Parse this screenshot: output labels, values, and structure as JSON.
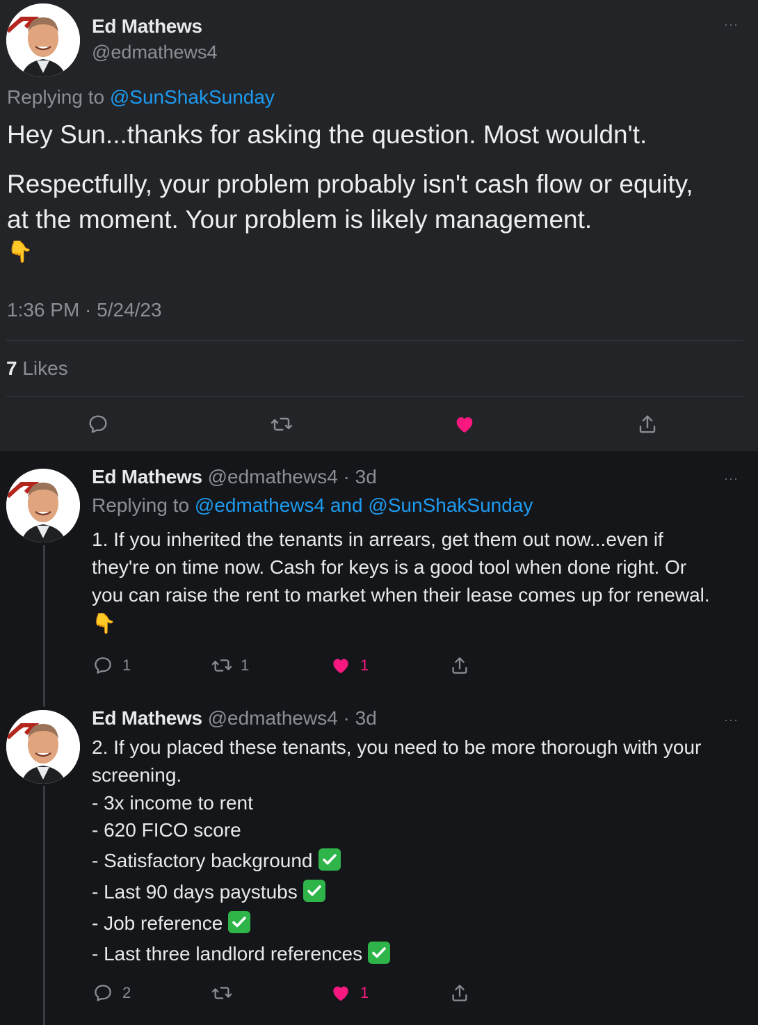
{
  "main_tweet": {
    "author_name": "Ed Mathews",
    "handle": "@edmathews4",
    "replying_prefix": "Replying to ",
    "replying_to": "@SunShakSunday",
    "paragraph1": "Hey Sun...thanks for asking the question. Most wouldn't.",
    "paragraph2_line1": "Respectfully, your problem probably isn't cash flow or equity,",
    "paragraph2_line2": "at the moment. Your problem is likely management.",
    "pointing_emoji": "👇",
    "timestamp": "1:36 PM · 5/24/23",
    "likes_count": "7",
    "likes_label": " Likes",
    "more_label": "···",
    "liked": true
  },
  "replies": [
    {
      "author_name": "Ed Mathews",
      "meta": " @edmathews4 · 3d",
      "more_label": "···",
      "replying_prefix": "Replying to ",
      "replying_to": "@edmathews4 and @SunShakSunday",
      "lines": [
        "1. If you inherited the tenants in arrears, get them out now...even if",
        "they're on time now. Cash for keys is a good tool when done right. Or",
        "you can raise the rent to market when their lease comes up for renewal."
      ],
      "pointing_emoji": "👇",
      "reply_count": "1",
      "retweet_count": "1",
      "like_count": "1"
    },
    {
      "author_name": "Ed Mathews",
      "meta": " @edmathews4 · 3d",
      "more_label": "···",
      "lines": [
        "2. If you placed these tenants, you need to be more thorough with your",
        "screening.",
        "- 3x income to rent",
        "- 620 FICO score"
      ],
      "checked_lines": [
        "- Satisfactory background",
        "- Last 90 days paystubs",
        "- Job reference",
        "- Last three landlord references"
      ],
      "reply_count": "2",
      "like_count": "1"
    }
  ],
  "colors": {
    "main_bg": "#232428",
    "page_bg": "#15161a",
    "link": "#1d9bf0",
    "like_pink": "#f91880",
    "muted": "#8b8f94",
    "check_green": "#2fb44a"
  },
  "icons": [
    "reply-icon",
    "retweet-icon",
    "like-icon",
    "share-icon",
    "more-icon",
    "check-icon",
    "pointing-down-emoji"
  ]
}
